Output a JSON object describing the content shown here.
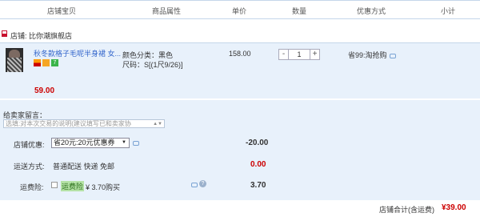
{
  "columns": [
    "店铺宝贝",
    "商品属性",
    "单价",
    "数量",
    "优惠方式",
    "小计"
  ],
  "shop": {
    "label": "店铺: 比你潮旗舰店"
  },
  "item": {
    "title": "秋冬款格子毛呢半身裙 女...",
    "badge_text": "7",
    "attr_color": "颜色分类：黑色",
    "attr_size": "尺码：S[(1尺9/26)]",
    "unit_price": "158.00",
    "qty_minus": "-",
    "quantity": "1",
    "qty_plus": "+",
    "promo": "省99:淘抢购",
    "subtotal": "59.00"
  },
  "memo": {
    "label": "给卖家留言：",
    "placeholder": "选填:对本次交易的说明(建议填写已和卖家协"
  },
  "shop_discount": {
    "label": "店铺优惠:",
    "selected": "省20元:20元优惠券",
    "amount": "-20.00"
  },
  "shipping": {
    "label": "运送方式:",
    "value": "普通配送 快递 免邮",
    "amount": "0.00"
  },
  "insurance": {
    "label": "运费险:",
    "tag": "运费险",
    "price": "¥ 3.70购买",
    "amount": "3.70"
  },
  "footer": {
    "label": "店铺合计(含运费)",
    "total": "¥39.00"
  },
  "colors": {
    "accent_red": "#c00000",
    "row_bg": "#e8f1fb",
    "link_blue": "#3366cc"
  }
}
